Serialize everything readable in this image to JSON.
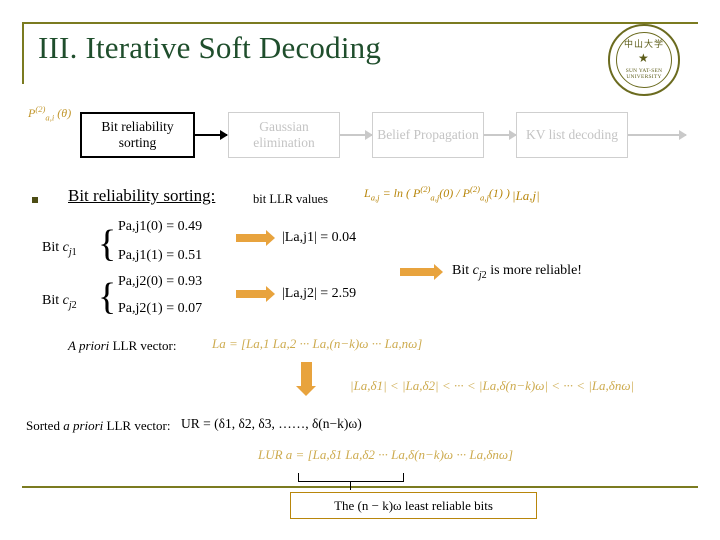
{
  "slide": {
    "title": "III. Iterative Soft Decoding",
    "seal": {
      "chinese": "中山大学",
      "english": "SUN YAT-SEN UNIVERSITY",
      "star": "★"
    }
  },
  "flow": {
    "input_label": "P(2)a,i (θ)",
    "boxes": [
      {
        "label": "Bit reliability sorting",
        "state": "active"
      },
      {
        "label": "Gaussian elimination",
        "state": "inactive"
      },
      {
        "label": "Belief Propagation",
        "state": "inactive"
      },
      {
        "label": "KV list decoding",
        "state": "inactive"
      }
    ]
  },
  "section": {
    "heading": "Bit reliability sorting:",
    "subtitle": "bit LLR values",
    "llr_definition": "La,j = ln ( P(2)a,j(0) / P(2)a,j(1) )",
    "llr_magnitude": "|La,j|"
  },
  "bits": [
    {
      "name": "Bit cj1",
      "probabilities": [
        "Pa,j1(0) = 0.49",
        "Pa,j1(1) = 0.51"
      ],
      "llr": "|La,j1| = 0.04"
    },
    {
      "name": "Bit cj2",
      "probabilities": [
        "Pa,j2(0) = 0.93",
        "Pa,j2(1) = 0.07"
      ],
      "llr": "|La,j2| = 2.59"
    }
  ],
  "conclusion": "Bit cj2 is more reliable!",
  "apriori": {
    "label_italic": "A priori",
    "label_rest": " LLR vector:",
    "equation": "La = [La,1  La,2  ···  La,(n−k)ω  ···  La,nω]"
  },
  "ordering_chain": "|La,δ1| < |La,δ2| < ··· < |La,δ(n−k)ω| < ··· < |La,δnω|",
  "sorted": {
    "label_pre": "Sorted ",
    "label_italic": "a priori",
    "label_post": " LLR vector:",
    "ur_equation": "UR = (δ1, δ2, δ3, ……, δ(n−k)ω)",
    "lur_equation": "LUR a = [La,δ1  La,δ2  ···  La,δ(n−k)ω  ···  La,δnω]"
  },
  "bottom_note": "The (n − k)ω least reliable bits",
  "colors": {
    "title_green": "#1f4e2c",
    "rule_olive": "#7b7b20",
    "ghost_gold": "#c8a23c",
    "fat_arrow_orange": "#e8a33d",
    "ghost_grey": "#c4c4c4"
  }
}
